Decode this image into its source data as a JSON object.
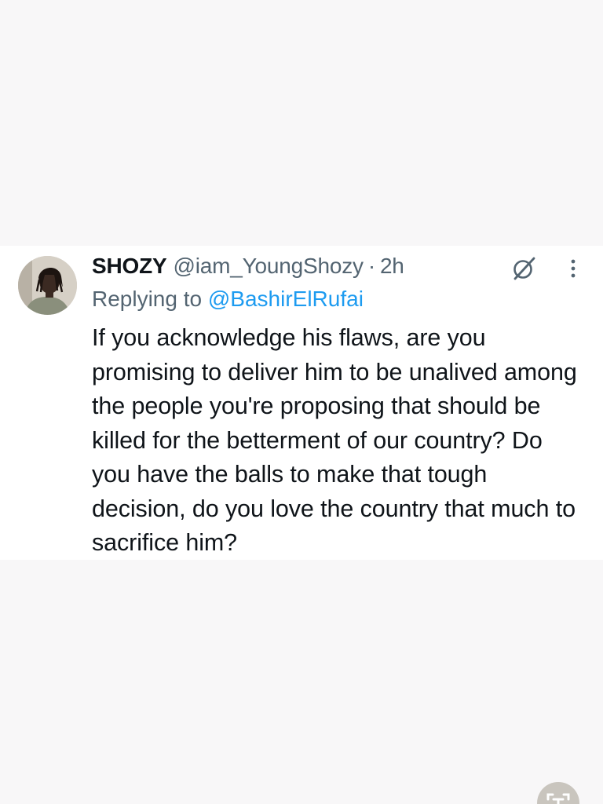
{
  "tweet": {
    "display_name": "SHOZY",
    "handle": "@iam_YoungShozy",
    "separator": "·",
    "timestamp": "2h",
    "reply_prefix": "Replying to",
    "reply_to": "@BashirElRufai",
    "body": "If you acknowledge his flaws, are you promising to deliver him to be unalived among the people you're proposing that should be killed for the betterment of our country? Do you have the balls to make that tough decision, do you love the country that much to sacrifice him?",
    "avatar_icon": "avatar-photo",
    "grok_icon": "grok-icon",
    "more_icon": "more-vertical-icon",
    "colors": {
      "link": "#1d9bf0",
      "secondary_text": "#536471",
      "primary_text": "#0f1419"
    }
  },
  "overlay": {
    "icon": "text-recognition-icon"
  }
}
